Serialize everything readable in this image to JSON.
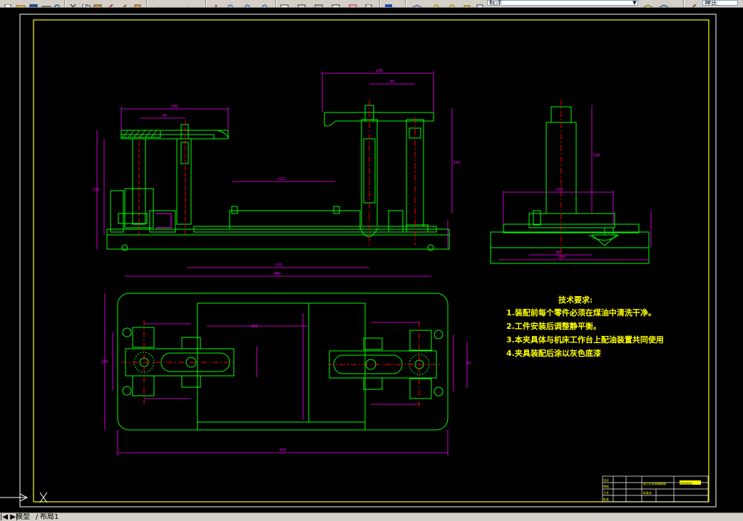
{
  "toolbar": {
    "layer_value": "标注",
    "style_value": "神氏",
    "icons": [
      "new-icon",
      "open-icon",
      "save-icon",
      "plot-icon",
      "preview-icon",
      "cut-icon",
      "copy-icon",
      "paste-icon",
      "match-icon",
      "undo-icon",
      "redo-icon",
      "pan-icon",
      "zoom-realtime-icon",
      "zoom-window-icon",
      "zoom-previous-icon",
      "properties-icon",
      "design-center-icon",
      "tool-palette-icon",
      "sheet-set-icon",
      "markup-icon",
      "calculator-icon",
      "help-icon",
      "layer-manager-icon",
      "layer-state-icon",
      "layer-prev-icon"
    ]
  },
  "tabs": {
    "model": "模型",
    "layout1": "布局1"
  },
  "notes": {
    "title": "技术要求:",
    "items": [
      "1.装配前每个零件必须在煤油中清洗干净。",
      "2.工件安装后调整静平衡。",
      "3.本夹具体与机床工作台上配油装置共同使用",
      "4.夹具装配后涂以灰色底漆"
    ]
  },
  "title_block": {
    "labels": [
      "设计",
      "审核",
      "工艺",
      "批准",
      "标准化"
    ],
    "drawing_name": "双工位夹具装配图",
    "company": "XXXXXXXXX"
  },
  "colors": {
    "geometry": "#00ff00",
    "dimension": "#ff00ff",
    "centerline": "#ff0000",
    "border": "#ffff00",
    "notes": "#ffff00"
  }
}
